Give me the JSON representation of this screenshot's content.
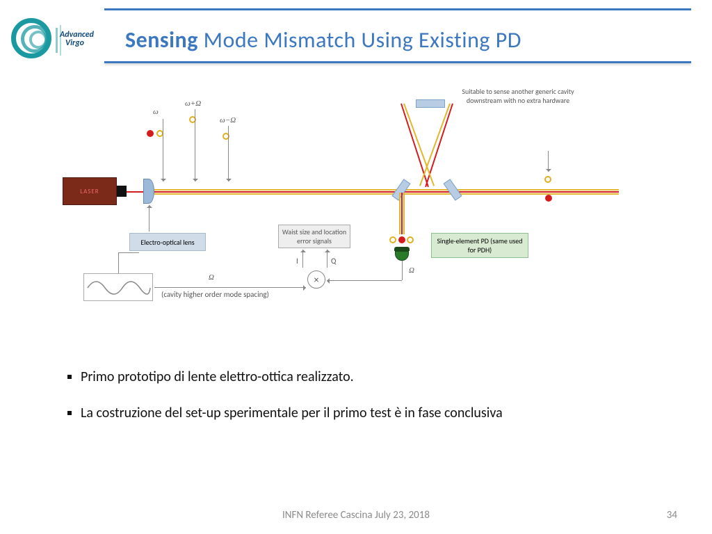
{
  "logo": {
    "line1": "Advanced",
    "line2": "Virgo"
  },
  "title": {
    "strong": "Sensing",
    "rest": " Mode Mismatch Using Existing PD"
  },
  "diagram": {
    "laser_label": "LASER",
    "eol_label": "Electro-optical lens",
    "waist_label": "Waist size and location error signals",
    "pd_label": "Single-element PD (same used for PDH)",
    "note_top": "Suitable to sense another generic cavity downstream with no extra hardware",
    "omega": "ω",
    "omega_p": "ω+Ω",
    "omega_m": "ω−Ω",
    "Omega_big": "Ω",
    "cavity_spacing": "(cavity higher order mode spacing)",
    "I": "I",
    "Q": "Q"
  },
  "bullets": [
    "Primo prototipo  di lente elettro-ottica realizzato.",
    "La costruzione del  set-up sperimentale per il primo test è in fase conclusiva"
  ],
  "footer": "INFN Referee  Cascina  July  23,  2018",
  "page": "34"
}
